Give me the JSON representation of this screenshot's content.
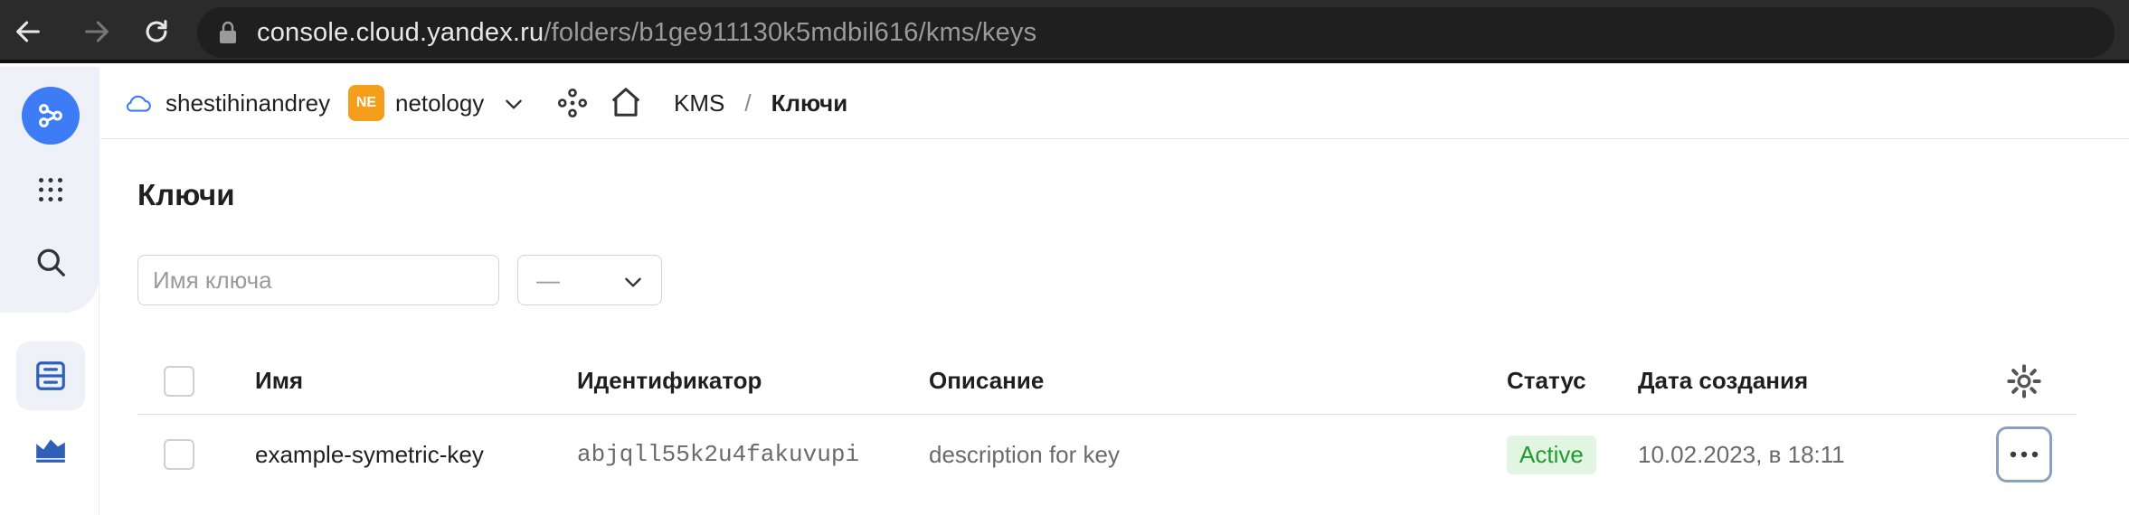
{
  "browser": {
    "url_host": "console.cloud.yandex.ru",
    "url_path": "/folders/b1ge911130k5mdbil616/kms/keys"
  },
  "header": {
    "account": "shestihinandrey",
    "org_badge": "NE",
    "org_name": "netology",
    "breadcrumb": {
      "service": "KMS",
      "separator": "/",
      "current": "Ключи"
    }
  },
  "main": {
    "title": "Ключи",
    "search": {
      "placeholder": "Имя ключа",
      "value": ""
    },
    "filter": {
      "value": "—"
    }
  },
  "table": {
    "columns": {
      "name": "Имя",
      "id": "Идентификатор",
      "description": "Описание",
      "status": "Статус",
      "created": "Дата создания"
    },
    "rows": [
      {
        "name": "example-symetric-key",
        "id": "abjqll55k2u4fakuvupi",
        "description": "description for key",
        "status": "Active",
        "created": "10.02.2023, в 18:11"
      }
    ]
  },
  "colors": {
    "accent": "#3d7cf5",
    "org_badge": "#f59e1b",
    "status_active_bg": "#e2f5e2",
    "status_active_text": "#1f9b2f"
  },
  "icons": {
    "browser": [
      "back-arrow-icon",
      "forward-arrow-icon",
      "reload-icon",
      "lock-icon"
    ],
    "rail": [
      "services-icon",
      "apps-grid-icon",
      "search-icon",
      "storage-icon",
      "monitoring-chart-icon"
    ],
    "header": [
      "cloud-icon",
      "chevron-down-icon",
      "service-graph-icon",
      "home-icon"
    ],
    "table": [
      "settings-gear-icon",
      "more-dots-icon"
    ]
  }
}
